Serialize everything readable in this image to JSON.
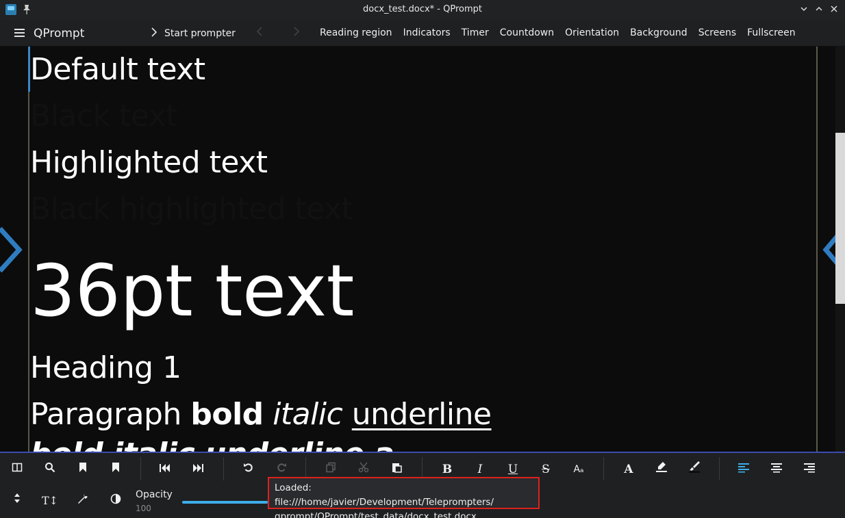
{
  "window": {
    "title": "docx_test.docx* - QPrompt",
    "buttons": [
      "⌄",
      "⌃",
      "✕"
    ]
  },
  "header": {
    "app_name": "QPrompt",
    "start_prompter": "Start prompter",
    "menu": [
      "Reading region",
      "Indicators",
      "Timer",
      "Countdown",
      "Orientation",
      "Background",
      "Screens",
      "Fullscreen"
    ]
  },
  "document": {
    "default_text": "Default text",
    "black_text": "Black text",
    "highlighted_text": "Highlighted text",
    "black_highlighted_text": "Black highlighted text",
    "pt36_text": "36pt text",
    "heading1": "Heading 1",
    "paragraph": {
      "word": "Paragraph",
      "bold": "bold",
      "italic": "italic",
      "underline": "underline"
    },
    "cut_line": "bold italic underline a"
  },
  "toolbar": {
    "icons": {
      "split": "columns-icon",
      "search": "search-icon",
      "bookmark1": "bookmark-icon",
      "bookmark2": "bookmark-filled-icon",
      "skip_back": "skip-back-icon",
      "skip_forward": "skip-forward-icon",
      "undo": "undo-icon",
      "redo": "redo-icon",
      "copy": "copy-icon",
      "cut": "scissors-icon",
      "paste": "paste-icon",
      "bold": "B",
      "italic": "I",
      "underline": "U",
      "strike": "S",
      "font_size": "Aₐ",
      "font": "A",
      "highlighter": "highlighter-icon",
      "brush": "brush-icon",
      "align_left": "align-left-icon",
      "align_center": "align-center-icon",
      "align_right": "align-right-icon",
      "updown": "up-down-icon",
      "text_size": "T↕",
      "wrench": "wrench-icon",
      "contrast": "contrast-icon"
    },
    "opacity_label": "Opacity",
    "opacity_value": "100",
    "opacity_fraction": 0.24
  },
  "status": {
    "line1": "Loaded: file:///home/javier/Development/Teleprompters/",
    "line2": "qprompt/QPrompt/test_data/docx_test.docx"
  },
  "colors": {
    "accent": "#3daee9",
    "status_border": "#e0201c",
    "toolbar_top": "#3c4bb0"
  }
}
